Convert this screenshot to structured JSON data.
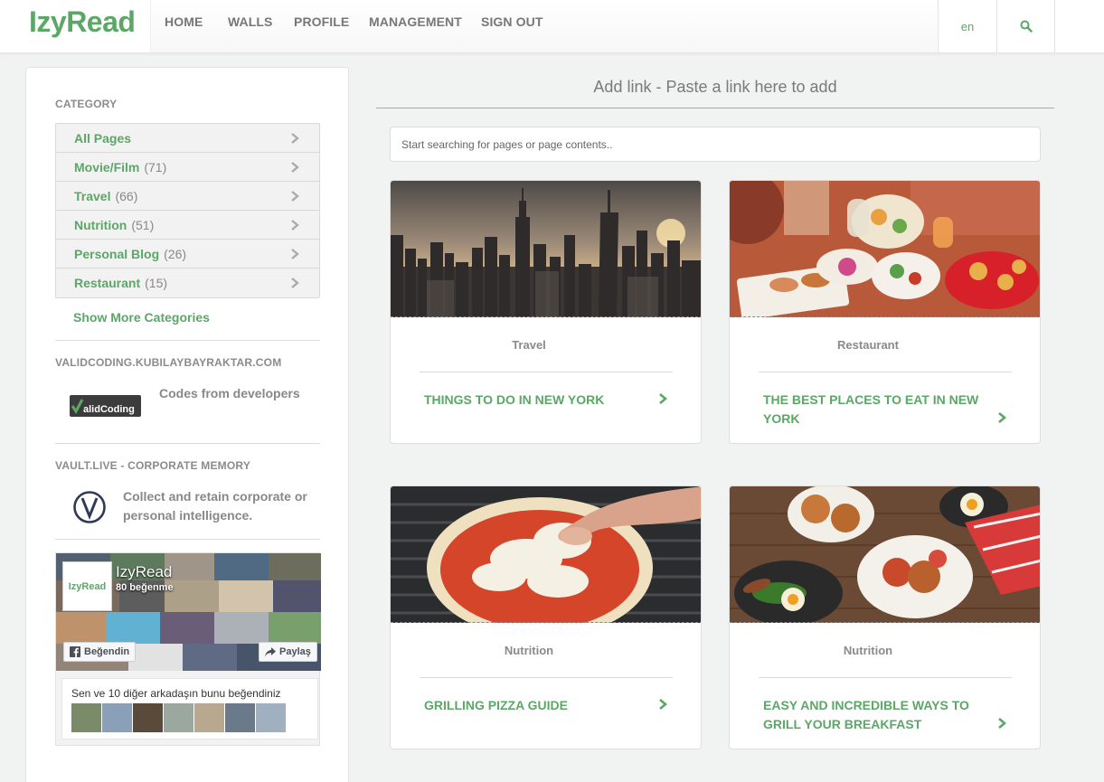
{
  "header": {
    "logo": "IzyRead",
    "nav": [
      "HOME",
      "WALLS",
      "PROFILE",
      "MANAGEMENT",
      "SIGN OUT"
    ],
    "lang": "en",
    "brand_color": "#5aa766"
  },
  "sidebar": {
    "category_title": "CATEGORY",
    "categories": [
      {
        "label": "All Pages",
        "count": ""
      },
      {
        "label": "Movie/Film",
        "count": "(71)"
      },
      {
        "label": "Travel",
        "count": "(66)"
      },
      {
        "label": "Nutrition",
        "count": "(51)"
      },
      {
        "label": "Personal Blog",
        "count": "(26)"
      },
      {
        "label": "Restaurant",
        "count": "(15)"
      }
    ],
    "show_more": "Show More Categories",
    "validcoding": {
      "title": "VALIDCODING.KUBILAYBAYRAKTAR.COM",
      "logo_text": "alidCoding",
      "desc": "Codes from developers"
    },
    "vault": {
      "title": "VAULT.LIVE - CORPORATE MEMORY",
      "desc": "Collect and retain corporate or personal intelligence."
    },
    "facebook": {
      "page_name": "IzyRead",
      "badge": "IzyRead",
      "likes": "80 beğenme",
      "like_button": "Beğendin",
      "share_button": "Paylaş",
      "friends_text": "Sen ve 10 diğer arkadaşın bunu beğendiniz"
    }
  },
  "main": {
    "add_link": "Add link - Paste a link here to add",
    "search_placeholder": "Start searching for pages or page contents..",
    "cards": [
      {
        "category": "Travel",
        "title": "THINGS TO DO IN NEW YORK"
      },
      {
        "category": "Restaurant",
        "title": "THE BEST PLACES TO EAT IN NEW YORK"
      },
      {
        "category": "Nutrition",
        "title": "GRILLING PIZZA GUIDE"
      },
      {
        "category": "Nutrition",
        "title": "EASY AND INCREDIBLE WAYS TO GRILL YOUR BREAKFAST"
      }
    ]
  }
}
